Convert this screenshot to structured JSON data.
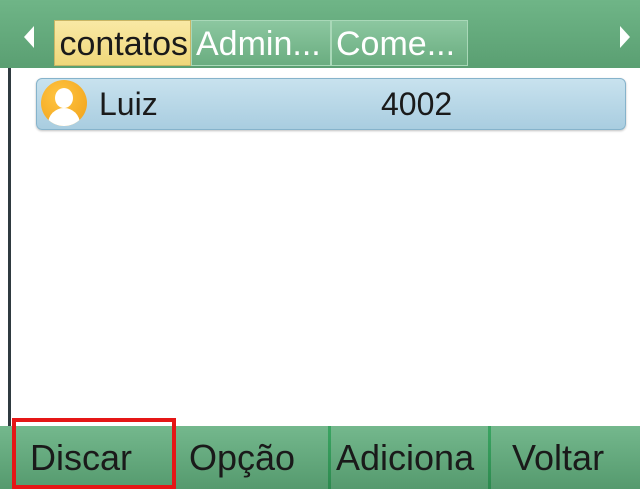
{
  "tabs": {
    "items": [
      {
        "label": "Todos os contatos"
      },
      {
        "label": "Admin..."
      },
      {
        "label": "Come..."
      }
    ],
    "active_index": 0
  },
  "contacts": [
    {
      "name": "Luiz",
      "number": "4002",
      "icon": "user-avatar-icon"
    }
  ],
  "softkeys": [
    {
      "label": "Discar"
    },
    {
      "label": "Opção"
    },
    {
      "label": "Adiciona"
    },
    {
      "label": "Voltar"
    }
  ],
  "colors": {
    "tabbar": "#5a9f72",
    "active_tab": "#efd77a",
    "selected_row": "#a9cde0",
    "softkey_bar": "#559a6e",
    "highlight": "#e51616"
  }
}
